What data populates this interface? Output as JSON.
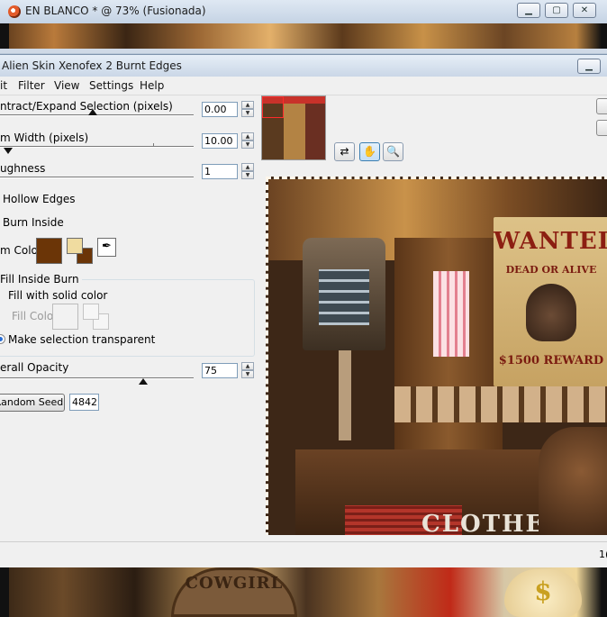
{
  "background_window": {
    "title": "EN BLANCO * @  73% (Fusionada)",
    "canvas_texts": {
      "cowgirl": "COWGIRL",
      "money": "$"
    }
  },
  "dialog": {
    "title": "Alien Skin Xenofex 2 Burnt Edges",
    "menu": [
      "it",
      "Filter",
      "View",
      "Settings",
      "Help"
    ],
    "controls": {
      "contract_expand": {
        "label": "ntract/Expand Selection (pixels)",
        "value": "0.00",
        "thumb_fraction": 0.49
      },
      "burn_width": {
        "label": "m Width (pixels)",
        "value": "10.00",
        "thumb_fraction": 0.0
      },
      "roughness": {
        "label": "ughness",
        "value": "1"
      },
      "hollow_edges": {
        "label": "Hollow Edges"
      },
      "burn_inside": {
        "label": "Burn Inside"
      },
      "burn_color": {
        "label": "m Color",
        "color": "#6b3507"
      },
      "fill_inside_burn": {
        "group_label": "Fill Inside Burn",
        "fill_solid": "Fill with solid color",
        "fill_color_label": "Fill Color",
        "make_transparent": "Make selection transparent"
      },
      "overall_opacity": {
        "label": "erall Opacity",
        "value": "75",
        "thumb_fraction": 0.75
      },
      "random_seed": {
        "button": "Random Seed",
        "value": "4842"
      }
    },
    "preview": {
      "tools": [
        "preview-toggle-icon",
        "hand-icon",
        "zoom-icon"
      ],
      "canvas_texts": {
        "wanted": "WANTED",
        "dead_or_alive": "DEAD OR ALIVE",
        "reward": "$1500 REWARD",
        "clothes": "CLOTHES"
      }
    },
    "status": "1("
  },
  "colors": {
    "accent": "#2a6fd6",
    "burn_color": "#6b3507",
    "swatch_light": "#f0dca0"
  }
}
